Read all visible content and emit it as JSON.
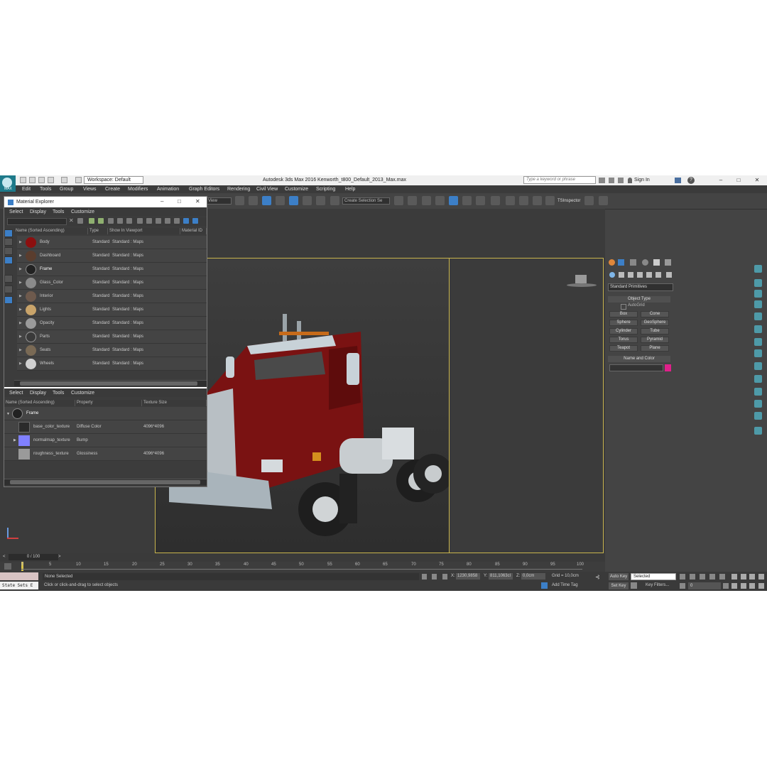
{
  "app": {
    "title": "Autodesk 3ds Max 2016    Kenworth_t800_Default_2013_Max.max",
    "workspace": "Workspace: Default",
    "search_placeholder": "Type a keyword or phrase",
    "sign_in": "Sign In",
    "logo_label": "MAX"
  },
  "menu": [
    "Edit",
    "Tools",
    "Group",
    "Views",
    "Create",
    "Modifiers",
    "Animation",
    "Graph Editors",
    "Rendering",
    "Civil View",
    "Customize",
    "Scripting",
    "Help"
  ],
  "toolbar": {
    "view_dropdown": "View",
    "selection_set": "Create Selection Se",
    "tsinspector": "TSInspector"
  },
  "material_explorer": {
    "title": "Material Explorer",
    "menu": [
      "Select",
      "Display",
      "Tools",
      "Customize"
    ],
    "columns": [
      "Name (Sorted Ascending)",
      "Type",
      "Show In Viewport",
      "Material ID"
    ],
    "rows": [
      {
        "name": "Body",
        "type": "Standard",
        "show": "Standard : Maps",
        "color": "#8c0f0f"
      },
      {
        "name": "Dashboard",
        "type": "Standard",
        "show": "Standard : Maps",
        "color": "#5a3d2e"
      },
      {
        "name": "Frame",
        "type": "Standard",
        "show": "Standard : Maps",
        "color": "#222222"
      },
      {
        "name": "Glass_Color",
        "type": "Standard",
        "show": "Standard : Maps",
        "color": "#8a8a8a"
      },
      {
        "name": "Interior",
        "type": "Standard",
        "show": "Standard : Maps",
        "color": "#6e5a4d"
      },
      {
        "name": "Lights",
        "type": "Standard",
        "show": "Standard : Maps",
        "color": "#c9a46a"
      },
      {
        "name": "Opacity",
        "type": "Standard",
        "show": "Standard : Maps",
        "color": "#9a9a9a"
      },
      {
        "name": "Parts",
        "type": "Standard",
        "show": "Standard : Maps",
        "color": "#3a3a3a"
      },
      {
        "name": "Seats",
        "type": "Standard",
        "show": "Standard : Maps",
        "color": "#7a6a55"
      },
      {
        "name": "Wheels",
        "type": "Standard",
        "show": "Standard : Maps",
        "color": "#d0d0d0"
      }
    ],
    "lower_menu": [
      "Select",
      "Display",
      "Tools",
      "Customize"
    ],
    "lower_columns": [
      "Name (Sorted Ascending)",
      "Property",
      "Texture Size"
    ],
    "lower_parent": "Frame",
    "lower_rows": [
      {
        "name": "base_color_texture",
        "property": "Diffuse Color",
        "size": "4096*4096",
        "color": "#2b2b2b"
      },
      {
        "name": "normalmap_texture",
        "property": "Bump",
        "size": "",
        "color": "#8080ff"
      },
      {
        "name": "roughness_texture",
        "property": "Glossiness",
        "size": "4096*4096",
        "color": "#9a9a9a"
      }
    ]
  },
  "command_panel": {
    "dropdown": "Standard Primitives",
    "object_type_header": "Object Type",
    "autogrid": "AutoGrid",
    "buttons": [
      "Box",
      "Cone",
      "Sphere",
      "GeoSphere",
      "Cylinder",
      "Tube",
      "Torus",
      "Pyramid",
      "Teapot",
      "Plane"
    ],
    "name_color_header": "Name and Color",
    "color_swatch": "#e0208a"
  },
  "timeline": {
    "frame": "0 / 100",
    "ticks": [
      "0",
      "5",
      "10",
      "15",
      "20",
      "25",
      "30",
      "35",
      "40",
      "45",
      "50",
      "55",
      "60",
      "65",
      "70",
      "75",
      "80",
      "85",
      "90",
      "95",
      "100"
    ]
  },
  "status": {
    "state_sets": "State Sets E",
    "selection": "None Selected",
    "prompt": "Click or click-and-drag to select objects",
    "x_label": "X:",
    "x_value": "1230,9858",
    "y_label": "Y:",
    "y_value": "811,1063cl",
    "z_label": "Z:",
    "z_value": "0,0cm",
    "grid": "Grid = 10,0cm",
    "add_time_tag": "Add Time Tag",
    "auto_key": "Auto Key",
    "set_key": "Set Key",
    "key_mode": "Selected",
    "key_filters": "Key Filters...",
    "frame_field": "0"
  }
}
